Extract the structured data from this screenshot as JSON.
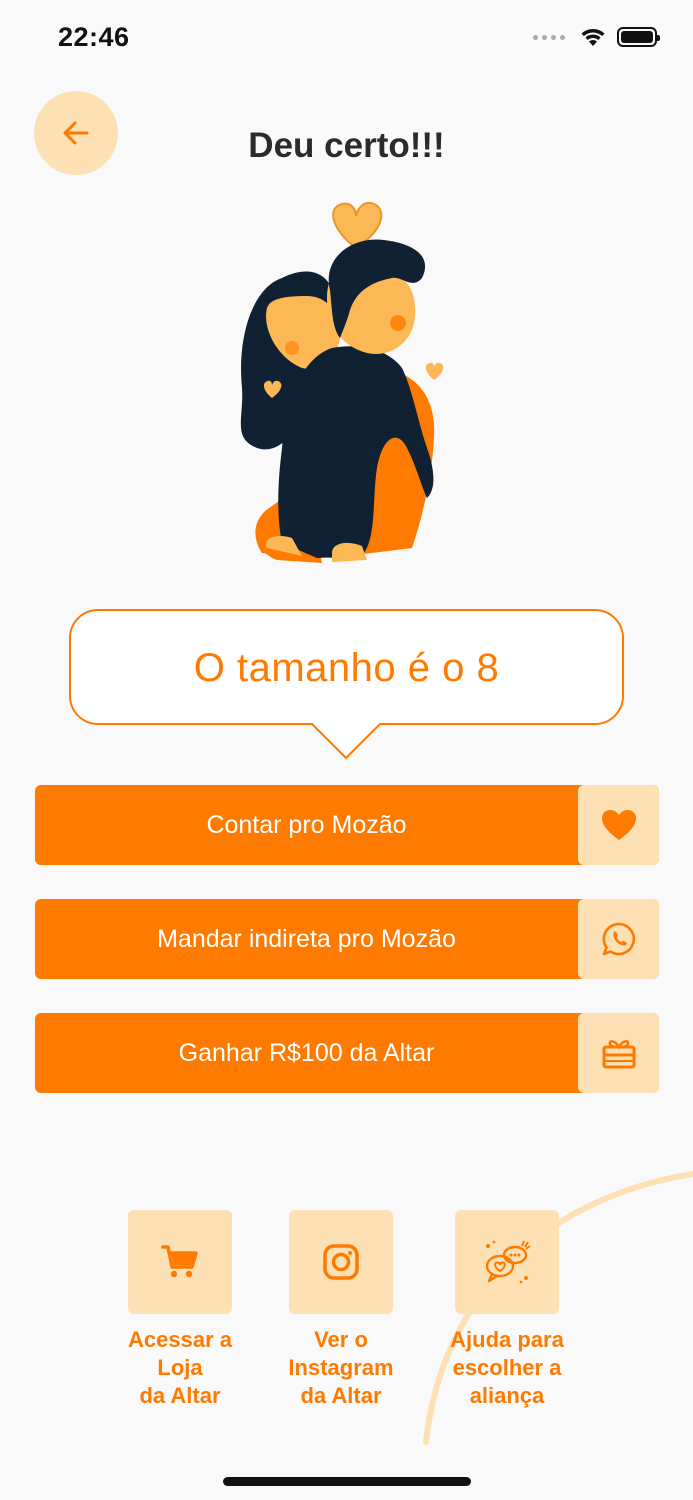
{
  "status_bar": {
    "time": "22:46"
  },
  "header": {
    "title": "Deu certo!!!"
  },
  "result": {
    "message": "O tamanho é o 8"
  },
  "actions": [
    {
      "label": "Contar pro Mozão",
      "icon": "heart-icon"
    },
    {
      "label": "Mandar indireta pro Mozão",
      "icon": "whatsapp-icon"
    },
    {
      "label": "Ganhar R$100 da Altar",
      "icon": "gift-icon"
    }
  ],
  "shortcuts": [
    {
      "label": "Acessar a\nLoja\nda Altar",
      "icon": "cart-icon"
    },
    {
      "label": "Ver o\nInstagram\nda Altar",
      "icon": "instagram-icon"
    },
    {
      "label": "Ajuda para\nescolher a\naliança",
      "icon": "chat-hearts-icon"
    }
  ],
  "colors": {
    "accent": "#ff7a00",
    "accent_light": "#fde0b4",
    "background": "#f9f9f9",
    "title": "#2b2b2b"
  }
}
